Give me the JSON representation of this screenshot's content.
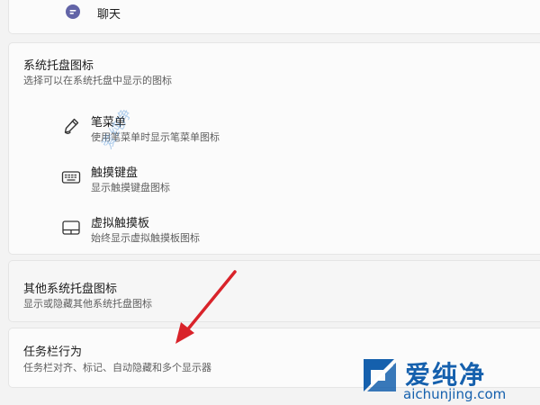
{
  "chat": {
    "label": "聊天",
    "icon": "chat-icon"
  },
  "tray": {
    "title": "系统托盘图标",
    "subtitle": "选择可以在系统托盘中显示的图标",
    "items": [
      {
        "title": "笔菜单",
        "desc": "使用笔菜单时显示笔菜单图标",
        "icon": "pen-icon"
      },
      {
        "title": "触摸键盘",
        "desc": "显示触摸键盘图标",
        "icon": "keyboard-icon"
      },
      {
        "title": "虚拟触摸板",
        "desc": "始终显示虚拟触摸板图标",
        "icon": "touchpad-icon"
      }
    ]
  },
  "other_tray": {
    "title": "其他系统托盘图标",
    "desc": "显示或隐藏其他系统托盘图标"
  },
  "taskbar_behavior": {
    "title": "任务栏行为",
    "desc": "任务栏对齐、标记、自动隐藏和多个显示器"
  },
  "watermark": {
    "brand": "爱纯净",
    "url": "aichunjing.com",
    "diagonal": "爱纯净"
  },
  "colors": {
    "accent": "#1560ad",
    "arrow": "#d9232a",
    "chat_icon": "#6264a7"
  }
}
